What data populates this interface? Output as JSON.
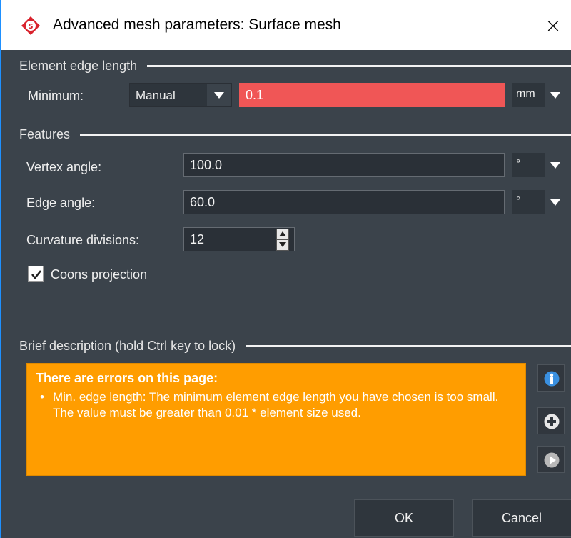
{
  "window": {
    "title": "Advanced mesh parameters: Surface mesh"
  },
  "element_edge_length": {
    "header": "Element edge length",
    "minimum_label": "Minimum:",
    "mode_value": "Manual",
    "value": "0.1",
    "unit": "mm"
  },
  "features": {
    "header": "Features",
    "vertex_angle_label": "Vertex angle:",
    "vertex_angle_value": "100.0",
    "vertex_angle_unit": "°",
    "edge_angle_label": "Edge angle:",
    "edge_angle_value": "60.0",
    "edge_angle_unit": "°",
    "curvature_label": "Curvature divisions:",
    "curvature_value": "12",
    "coons_label": "Coons projection",
    "coons_checked": true
  },
  "description": {
    "header": "Brief description (hold Ctrl key to lock)",
    "error_title": "There are errors on this page:",
    "error_text": "Min. edge length: The minimum element edge length you have chosen is too small. The value must be greater than 0.01 * element size used."
  },
  "buttons": {
    "ok": "OK",
    "cancel": "Cancel"
  },
  "colors": {
    "accent_error": "#f05656",
    "description_bg": "#ff9d00",
    "dialog_bg": "#3b434b",
    "logo_red": "#d9232d"
  },
  "icons": {
    "close": "×",
    "info": "info-icon",
    "plus": "plus-icon",
    "play": "play-icon"
  }
}
